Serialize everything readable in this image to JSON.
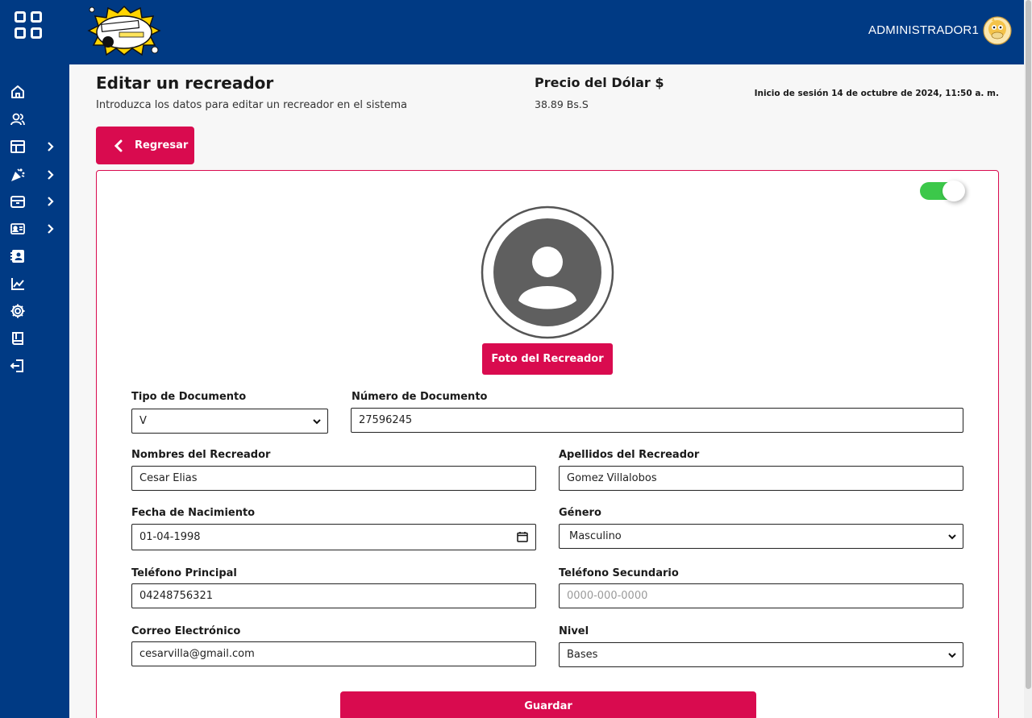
{
  "header": {
    "user_name": "ADMINISTRADOR1"
  },
  "sidebar": {
    "items": [
      {
        "icon": "home-icon",
        "has_submenu": false
      },
      {
        "icon": "users-icon",
        "has_submenu": false
      },
      {
        "icon": "layout-icon",
        "has_submenu": true
      },
      {
        "icon": "party-icon",
        "has_submenu": true
      },
      {
        "icon": "archive-icon",
        "has_submenu": true
      },
      {
        "icon": "id-card-icon",
        "has_submenu": true
      },
      {
        "icon": "contact-book-icon",
        "has_submenu": false
      },
      {
        "icon": "chart-line-icon",
        "has_submenu": false
      },
      {
        "icon": "gear-icon",
        "has_submenu": false
      },
      {
        "icon": "book-icon",
        "has_submenu": false
      },
      {
        "icon": "logout-icon",
        "has_submenu": false
      }
    ]
  },
  "page": {
    "title": "Editar un recreador",
    "subtitle": "Introduzca los datos para editar un recreador en el sistema",
    "rate_title": "Precio del Dólar $",
    "rate_value": "38.89 Bs.S",
    "session": "Inicio de sesión 14 de octubre de 2024, 11:50 a. m.",
    "back_label": "Regresar"
  },
  "form": {
    "active": true,
    "photo_label": "Foto del Recreador",
    "doc_type_label": "Tipo de Documento",
    "doc_type_value": "V",
    "doc_number_label": "Número de Documento",
    "doc_number_value": "27596245",
    "first_names_label": "Nombres del Recreador",
    "first_names_value": "Cesar Elias",
    "last_names_label": "Apellidos del Recreador",
    "last_names_value": "Gomez Villalobos",
    "birth_label": "Fecha de Nacimiento",
    "birth_value": "01-04-1998",
    "gender_label": "Género",
    "gender_value": "Masculino",
    "phone1_label": "Teléfono Principal",
    "phone1_value": "04248756321",
    "phone2_label": "Teléfono Secundario",
    "phone2_placeholder": "0000-000-0000",
    "email_label": "Correo Electrónico",
    "email_value": "cesarvilla@gmail.com",
    "level_label": "Nivel",
    "level_value": "Bases",
    "save_label": "Guardar"
  },
  "colors": {
    "primary": "#003a84",
    "accent": "#d90b4f",
    "toggle_on": "#3cc84a"
  }
}
